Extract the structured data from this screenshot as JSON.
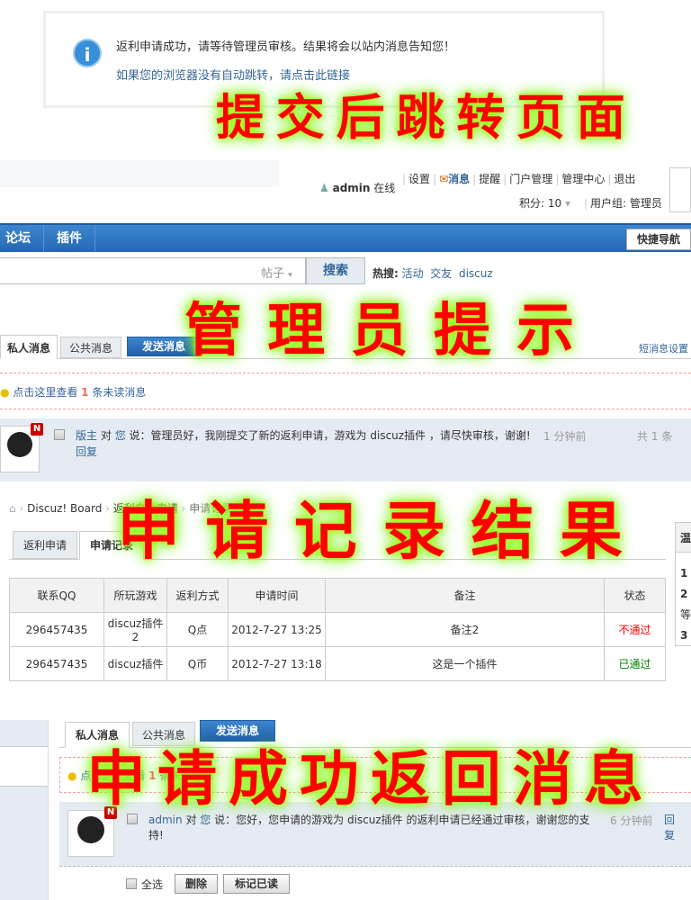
{
  "overlays": [
    "提 交 后 跳 转 页 面",
    "管 理 员 提 示",
    "申 请 记 录 结 果",
    "申 请 成 功 返 回 消 息"
  ],
  "notice": {
    "icon": "info-icon",
    "message": "返利申请成功，请等待管理员审核。结果将会以站内消息告知您！",
    "link": "如果您的浏览器没有自动跳转，请点击此链接"
  },
  "userbar": {
    "username": "admin",
    "status": "在线",
    "links": [
      "设置",
      "消息",
      "提醒",
      "门户管理",
      "管理中心",
      "退出"
    ],
    "credits": "积分: 10",
    "group": "用户组: 管理员"
  },
  "nav": {
    "items": [
      "论坛",
      "插件"
    ],
    "quick": "快捷导航"
  },
  "search": {
    "type": "帖子",
    "button": "搜索",
    "hot_label": "热搜:",
    "hot": [
      "活动",
      "交友",
      "discuz"
    ]
  },
  "pm1": {
    "tabs": [
      "私人消息",
      "公共消息",
      "发送消息"
    ],
    "settings": "短消息设置",
    "unread_pre": "点击这里查看",
    "unread_count": "1",
    "unread_post": "条未读消息",
    "from": "版主",
    "to_word": "对",
    "to": "您",
    "say": "说：",
    "text": "管理员好，我刚提交了新的返利申请，游戏为 discuz插件 ，请尽快审核，谢谢!",
    "time": "1 分钟前",
    "reply": "回复",
    "total": "共 1 条",
    "badge": "N"
  },
  "breadcrumb": [
    "Discuz! Board",
    "返利自助申请",
    "申请记录"
  ],
  "records": {
    "tabs": [
      "返利申请",
      "申请记录"
    ],
    "headers": [
      "联系QQ",
      "所玩游戏",
      "返利方式",
      "申请时间",
      "备注",
      "状态"
    ],
    "rows": [
      [
        "296457435",
        "discuz插件2",
        "Q点",
        "2012-7-27 13:25",
        "备注2",
        "不通过"
      ],
      [
        "296457435",
        "discuz插件",
        "Q币",
        "2012-7-27 13:18",
        "这是一个插件",
        "已通过"
      ]
    ],
    "status_colors": {
      "不通过": "#ff0000",
      "已通过": "#008000"
    },
    "side": {
      "title": "温",
      "items": [
        "1",
        "2",
        "等",
        "3"
      ]
    }
  },
  "pm2": {
    "tabs": [
      "私人消息",
      "公共消息",
      "发送消息"
    ],
    "unread_pre": "点击这里查看",
    "unread_count": "1",
    "unread_post": "条未读消息",
    "from": "admin",
    "to_word": "对",
    "to": "您",
    "say": "说：",
    "text": "您好，您申请的游戏为 discuz插件 的返利申请已经通过审核，谢谢您的支持!",
    "time": "6 分钟前",
    "reply": "回复",
    "badge": "N",
    "select_all": "全选",
    "delete": "删除",
    "mark_read": "标记已读"
  }
}
